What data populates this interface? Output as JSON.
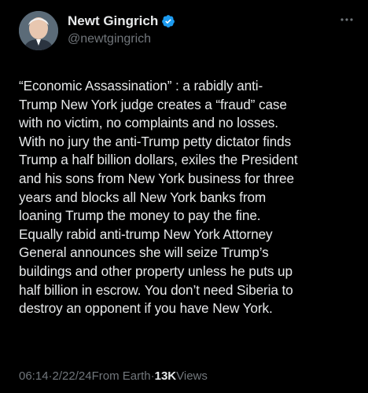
{
  "author": {
    "display_name": "Newt Gingrich",
    "handle": "@newtgingrich",
    "verified_badge_icon": "verified-badge-icon",
    "verified_color": "#1d9bf0"
  },
  "more_icon": "more-horizontal-icon",
  "tweet": {
    "text": "“Economic Assassination” : a rabidly anti-\nTrump New York judge creates a “fraud” case\nwith no victim, no complaints and no losses.\nWith no jury the anti-Trump petty dictator finds\nTrump a half billion dollars, exiles the President\nand his sons from New York business for three\nyears and blocks all New York banks from\nloaning Trump the money to pay the fine.\nEqually rabid anti-trump New York Attorney\nGeneral announces she will seize Trump’s\nbuildings and other property unless he puts up\nhalf billion in escrow. You don’t need Siberia to\ndestroy an opponent if you have New York."
  },
  "meta": {
    "time": "06:14",
    "separator": " · ",
    "date": "2/22/24",
    "source": " From Earth",
    "views_count": "13K",
    "views_label": " Views"
  },
  "colors": {
    "background": "#000000",
    "text": "#e7e9ea",
    "secondary": "#71767b"
  }
}
